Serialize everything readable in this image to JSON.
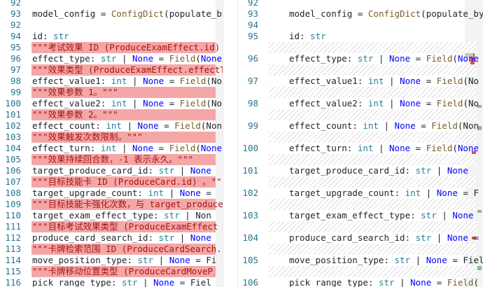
{
  "left_pane": {
    "lines": [
      {
        "n": "92",
        "t": "",
        "type": "ctx"
      },
      {
        "n": "93",
        "t": "model_config = ConfigDict(populate_by",
        "type": "ctx"
      },
      {
        "n": "92",
        "t": "",
        "type": "ctx"
      },
      {
        "n": "94",
        "t": "id: str",
        "type": "ctx"
      },
      {
        "n": "95",
        "t": "\"\"\"考试效果 ID (ProduceExamEffect.id)",
        "type": "del"
      },
      {
        "n": "96",
        "t": "effect_type: str | None = Field(None",
        "type": "ctx"
      },
      {
        "n": "97",
        "t": "\"\"\"效果类型 (ProduceExamEffect.effectTy",
        "type": "del"
      },
      {
        "n": "98",
        "t": "effect_value1: int | None = Field(No",
        "type": "ctx"
      },
      {
        "n": "99",
        "t": "\"\"\"效果参数 1。\"\"\"",
        "type": "del"
      },
      {
        "n": "100",
        "t": "effect_value2: int | None = Field(No",
        "type": "ctx"
      },
      {
        "n": "101",
        "t": "\"\"\"效果参数 2。\"\"\"",
        "type": "del"
      },
      {
        "n": "102",
        "t": "effect_count: int | None = Field(Non",
        "type": "ctx"
      },
      {
        "n": "103",
        "t": "\"\"\"效果触发次数限制。\"\"\"",
        "type": "del"
      },
      {
        "n": "104",
        "t": "effect_turn: int | None = Field(None",
        "type": "ctx"
      },
      {
        "n": "105",
        "t": "\"\"\"效果持续回合数，-1 表示永久。\"\"\"",
        "type": "del"
      },
      {
        "n": "106",
        "t": "target_produce_card_id: str | None",
        "type": "ctx"
      },
      {
        "n": "107",
        "t": "\"\"\"目标技能卡 ID (ProduceCard.id) 。\"\"\"",
        "type": "del"
      },
      {
        "n": "108",
        "t": "target_upgrade_count: int | None =",
        "type": "ctx"
      },
      {
        "n": "109",
        "t": "\"\"\"目标技能卡强化次数，与 target_produce",
        "type": "del"
      },
      {
        "n": "110",
        "t": "target_exam_effect_type: str | Non",
        "type": "ctx"
      },
      {
        "n": "111",
        "t": "\"\"\"目标考试效果类型 (ProduceExamEffect",
        "type": "del"
      },
      {
        "n": "112",
        "t": "produce_card_search_id: str | None",
        "type": "ctx"
      },
      {
        "n": "113",
        "t": "\"\"\"卡牌检索范围 ID (ProduceCardSearch.",
        "type": "del"
      },
      {
        "n": "114",
        "t": "move_position_type: str | None = Fi",
        "type": "ctx"
      },
      {
        "n": "115",
        "t": "\"\"\"卡牌移动位置类型 (ProduceCardMoveP",
        "type": "del"
      },
      {
        "n": "116",
        "t": "pick_range_type: str | None = Fiel",
        "type": "ctx"
      }
    ]
  },
  "right_pane": {
    "lines": [
      {
        "n": "92",
        "t": "",
        "type": "ctx"
      },
      {
        "n": "93",
        "t": "model_config = ConfigDict(populate_by",
        "type": "ctx"
      },
      {
        "n": "94",
        "t": "",
        "type": "ctx"
      },
      {
        "n": "95",
        "t": "id: str",
        "type": "ctx"
      },
      {
        "n": "",
        "t": "",
        "type": "pad"
      },
      {
        "n": "96",
        "t": "effect_type: str | None = Field(None",
        "type": "ctx"
      },
      {
        "n": "",
        "t": "",
        "type": "pad"
      },
      {
        "n": "97",
        "t": "effect_value1: int | None = Field(No",
        "type": "ctx"
      },
      {
        "n": "",
        "t": "",
        "type": "pad"
      },
      {
        "n": "98",
        "t": "effect_value2: int | None = Field(No",
        "type": "ctx"
      },
      {
        "n": "",
        "t": "",
        "type": "pad"
      },
      {
        "n": "99",
        "t": "effect_count: int | None = Field(Non",
        "type": "ctx"
      },
      {
        "n": "",
        "t": "",
        "type": "pad"
      },
      {
        "n": "100",
        "t": "effect_turn: int | None = Field(None",
        "type": "ctx"
      },
      {
        "n": "",
        "t": "",
        "type": "pad"
      },
      {
        "n": "101",
        "t": "target_produce_card_id: str | None",
        "type": "ctx"
      },
      {
        "n": "",
        "t": "",
        "type": "pad"
      },
      {
        "n": "102",
        "t": "target_upgrade_count: int | None = F",
        "type": "ctx"
      },
      {
        "n": "",
        "t": "",
        "type": "pad"
      },
      {
        "n": "103",
        "t": "target_exam_effect_type: str | None",
        "type": "ctx"
      },
      {
        "n": "",
        "t": "",
        "type": "pad"
      },
      {
        "n": "104",
        "t": "produce_card_search_id: str | None =",
        "type": "ctx"
      },
      {
        "n": "",
        "t": "",
        "type": "pad"
      },
      {
        "n": "105",
        "t": "move_position_type: str | None = Fiel",
        "type": "ctx"
      },
      {
        "n": "",
        "t": "",
        "type": "pad"
      },
      {
        "n": "106",
        "t": "pick_range_type: str | None = Field(",
        "type": "ctx"
      }
    ]
  },
  "colors": {
    "removed": "#f4a7a7",
    "line_number": "#237893",
    "keyword": "#0000ff",
    "type": "#267f99",
    "function": "#795e26"
  }
}
